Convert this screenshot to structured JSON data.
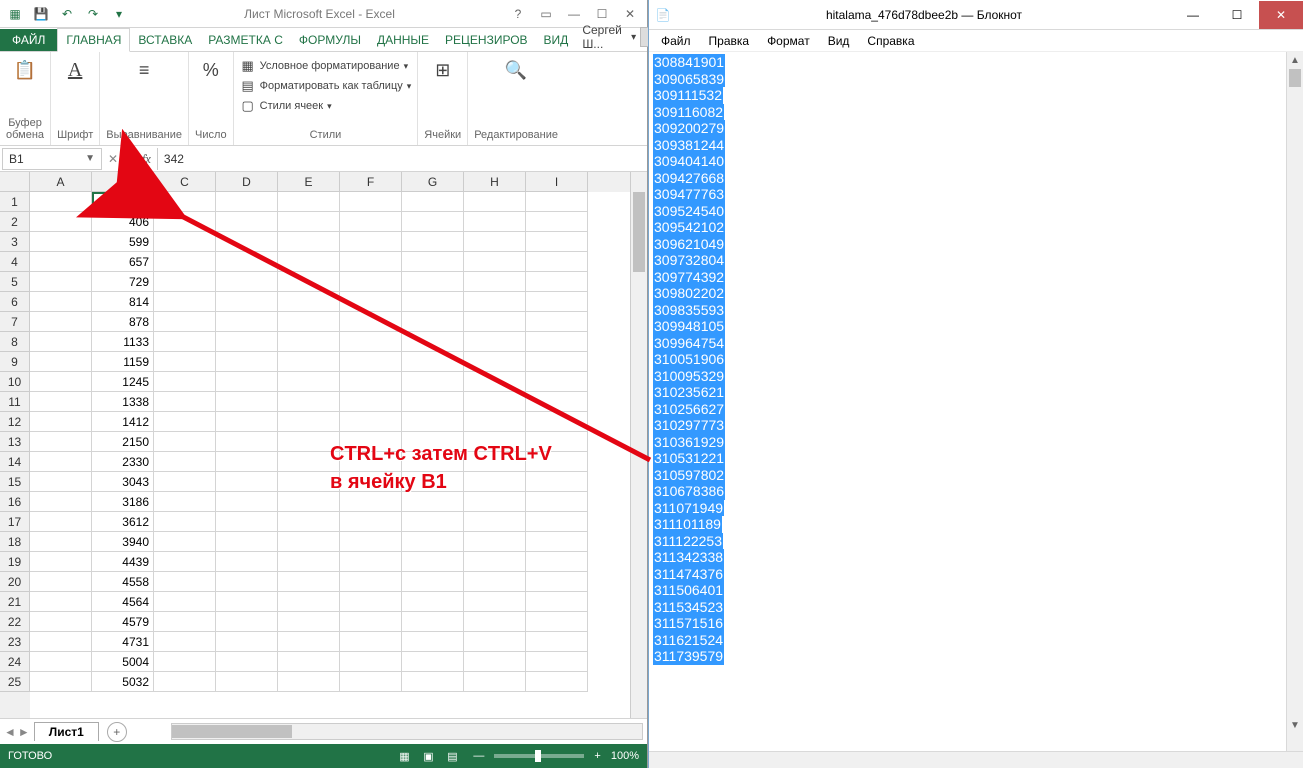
{
  "excel": {
    "title": "Лист Microsoft Excel - Excel",
    "tabs": {
      "file": "ФАЙЛ",
      "home": "ГЛАВНАЯ",
      "insert": "ВСТАВКА",
      "layout": "РАЗМЕТКА С",
      "formulas": "ФОРМУЛЫ",
      "data": "ДАННЫЕ",
      "review": "РЕЦЕНЗИРОВ",
      "view": "ВИД"
    },
    "user": "Сергей Ш...",
    "ribbon": {
      "clipboard": {
        "label": "Буфер\nобмена",
        "group": ""
      },
      "font": {
        "label": "Шрифт"
      },
      "alignment": {
        "label": "Выравнивание"
      },
      "number": {
        "label": "Число"
      },
      "styles": {
        "conditional": "Условное форматирование",
        "format_table": "Форматировать как таблицу",
        "cell_styles": "Стили ячеек",
        "group": "Стили"
      },
      "cells": {
        "label": "Ячейки"
      },
      "editing": {
        "label": "Редактирование"
      }
    },
    "namebox": "B1",
    "formula": "342",
    "columns": [
      "A",
      "B",
      "C",
      "D",
      "E",
      "F",
      "G",
      "H",
      "I"
    ],
    "rows": [
      {
        "n": 1,
        "b": "342"
      },
      {
        "n": 2,
        "b": "406"
      },
      {
        "n": 3,
        "b": "599"
      },
      {
        "n": 4,
        "b": "657"
      },
      {
        "n": 5,
        "b": "729"
      },
      {
        "n": 6,
        "b": "814"
      },
      {
        "n": 7,
        "b": "878"
      },
      {
        "n": 8,
        "b": "1133"
      },
      {
        "n": 9,
        "b": "1159"
      },
      {
        "n": 10,
        "b": "1245"
      },
      {
        "n": 11,
        "b": "1338"
      },
      {
        "n": 12,
        "b": "1412"
      },
      {
        "n": 13,
        "b": "2150"
      },
      {
        "n": 14,
        "b": "2330"
      },
      {
        "n": 15,
        "b": "3043"
      },
      {
        "n": 16,
        "b": "3186"
      },
      {
        "n": 17,
        "b": "3612"
      },
      {
        "n": 18,
        "b": "3940"
      },
      {
        "n": 19,
        "b": "4439"
      },
      {
        "n": 20,
        "b": "4558"
      },
      {
        "n": 21,
        "b": "4564"
      },
      {
        "n": 22,
        "b": "4579"
      },
      {
        "n": 23,
        "b": "4731"
      },
      {
        "n": 24,
        "b": "5004"
      },
      {
        "n": 25,
        "b": "5032"
      }
    ],
    "sheet": "Лист1",
    "status": "ГОТОВО",
    "zoom": "100%"
  },
  "notepad": {
    "title": "hitalama_476d78dbee2b — Блокнот",
    "menu": {
      "file": "Файл",
      "edit": "Правка",
      "format": "Формат",
      "view": "Вид",
      "help": "Справка"
    },
    "lines": [
      "308841901",
      "309065839",
      "309111532",
      "309116082",
      "309200279",
      "309381244",
      "309404140",
      "309427668",
      "309477763",
      "309524540",
      "309542102",
      "309621049",
      "309732804",
      "309774392",
      "309802202",
      "309835593",
      "309948105",
      "309964754",
      "310051906",
      "310095329",
      "310235621",
      "310256627",
      "310297773",
      "310361929",
      "310531221",
      "310597802",
      "310678386",
      "311071949",
      "311101189",
      "311122253",
      "311342338",
      "311474376",
      "311506401",
      "311534523",
      "311571516",
      "311621524",
      "311739579"
    ]
  },
  "annotation": {
    "line1": "CTRL+c  затем CTRL+V",
    "line2": "в ячейку B1"
  }
}
